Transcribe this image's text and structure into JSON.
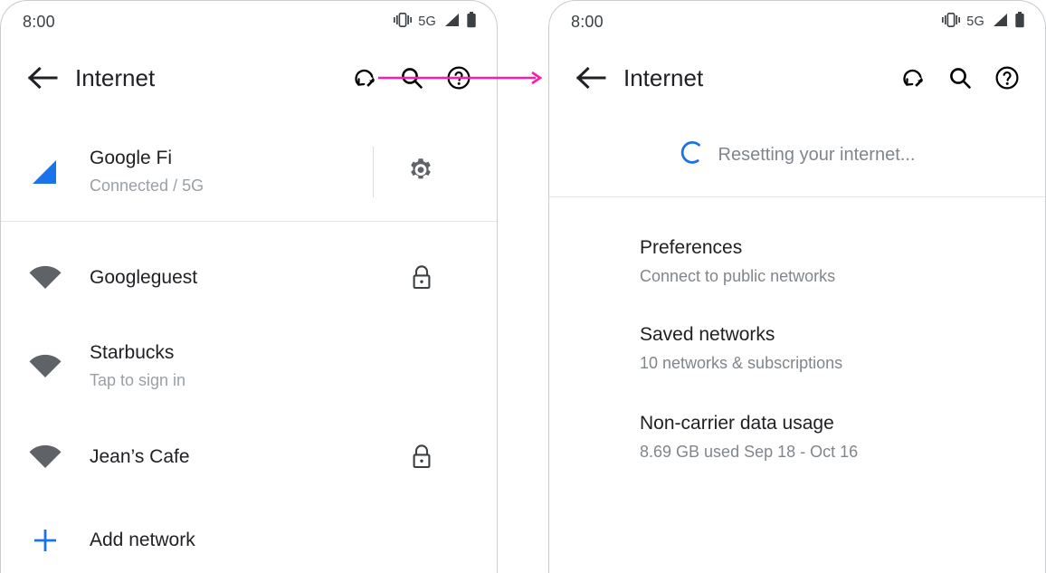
{
  "colors": {
    "accent_blue": "#1a73e8",
    "arrow_pink": "#ff1aa8",
    "text_primary": "#202124",
    "text_secondary": "#9aa0a6",
    "divider": "#e3e4e6",
    "icon_dark": "#5f6368"
  },
  "annotation": {
    "arrow_name": "flow-arrow",
    "direction": "left-to-right"
  },
  "screens": [
    {
      "id": "internet-network-list",
      "status_bar": {
        "time": "8:00",
        "network_label": "5G",
        "icons": [
          "vibrate-icon",
          "signal-icon",
          "battery-icon"
        ]
      },
      "app_bar": {
        "back_label": "back-arrow",
        "title": "Internet",
        "actions": [
          {
            "name": "reset-connectivity-icon",
            "label": "Reset connectivity"
          },
          {
            "name": "search-icon",
            "label": "Search"
          },
          {
            "name": "help-icon",
            "label": "Help"
          }
        ]
      },
      "carrier_row": {
        "icon": "mobile-signal-icon",
        "title": "Google Fi",
        "subtitle": "Connected / 5G",
        "settings_icon": "gear-icon"
      },
      "networks": [
        {
          "icon": "wifi-icon",
          "title": "Googleguest",
          "subtitle": "",
          "trailing": "lock-icon"
        },
        {
          "icon": "wifi-icon",
          "title": "Starbucks",
          "subtitle": "Tap to sign in",
          "trailing": ""
        },
        {
          "icon": "wifi-icon",
          "title": "Jean’s Cafe",
          "subtitle": "",
          "trailing": "lock-icon"
        }
      ],
      "add_network": {
        "icon": "plus-icon",
        "label": "Add network"
      }
    },
    {
      "id": "internet-resetting",
      "status_bar": {
        "time": "8:00",
        "network_label": "5G",
        "icons": [
          "vibrate-icon",
          "signal-icon",
          "battery-icon"
        ]
      },
      "app_bar": {
        "back_label": "back-arrow",
        "title": "Internet",
        "actions": [
          {
            "name": "reset-connectivity-icon",
            "label": "Reset connectivity"
          },
          {
            "name": "search-icon",
            "label": "Search"
          },
          {
            "name": "help-icon",
            "label": "Help"
          }
        ]
      },
      "progress": {
        "icon": "loading-spinner-icon",
        "text": "Resetting your internet..."
      },
      "settings": [
        {
          "title": "Preferences",
          "subtitle": "Connect to public networks"
        },
        {
          "title": "Saved networks",
          "subtitle": "10 networks & subscriptions"
        },
        {
          "title": "Non-carrier data usage",
          "subtitle": "8.69 GB used Sep 18 - Oct 16"
        }
      ]
    }
  ]
}
